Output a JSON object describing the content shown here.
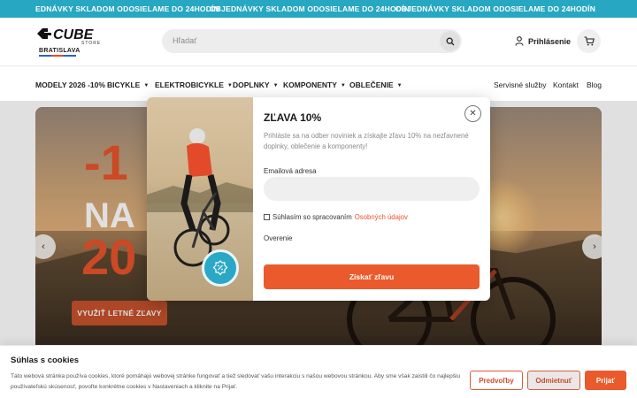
{
  "ticker": {
    "items": [
      "EDNÁVKY SKLADOM ODOSIELAME DO 24HODÍN",
      "OBJEDNÁVKY SKLADOM ODOSIELAME DO 24HODÍN",
      "OBJEDNÁVKY SKLADOM ODOSIELAME DO 24HODÍN"
    ]
  },
  "header": {
    "logo_text": "CUBE",
    "logo_sub": "STORE",
    "location": "BRATISLAVA",
    "search_placeholder": "Hľadať",
    "login_label": "Prihlásenie"
  },
  "nav": {
    "left": [
      "MODELY 2026 -10%",
      "BICYKLE",
      "ELEKTROBICYKLE",
      "DOPLNKY",
      "KOMPONENTY",
      "OBLEČENIE"
    ],
    "right": [
      "Servisné služby",
      "Kontakt",
      "Blog"
    ]
  },
  "hero": {
    "promo_line1": "-1",
    "promo_line2": "NA",
    "promo_line3": "20",
    "cta_label": "VYUŽIŤ LETNÉ ZĽAVY"
  },
  "modal": {
    "title": "ZĽAVA 10%",
    "description": "Prihláste sa na odber noviniek a získajte zľavu 10% na nezľavnené doplnky, oblečenie a komponenty!",
    "email_label": "Emailová adresa",
    "consent_text": "Súhlasím so spracovaním",
    "consent_link": "Osobných údajov",
    "verify_label": "Overenie",
    "submit_label": "Získať zľavu"
  },
  "cookie": {
    "title": "Súhlas s cookies",
    "text": "Táto webová stránka používa cookies, ktoré pomáhajú webovej stránke fungovať a tiež sledovať vašu interakciu s našou webovou stránkou. Aby sme však zaistili čo najlepšiu používateľskú skúsenosť, povoľte konkrétne cookies v Nastaveniach a kliknite na Prijať.",
    "pref_label": "Predvoľby",
    "deny_label": "Odmietnuť",
    "accept_label": "Prijať"
  },
  "colors": {
    "ticker_bg": "#27a7c2",
    "accent": "#ea5a2c",
    "badge": "#2aa8c6"
  },
  "icons": [
    "cube-logo",
    "search-icon",
    "user-icon",
    "cart-icon",
    "chevron-left-icon",
    "chevron-right-icon",
    "close-icon",
    "discount-badge-icon"
  ]
}
